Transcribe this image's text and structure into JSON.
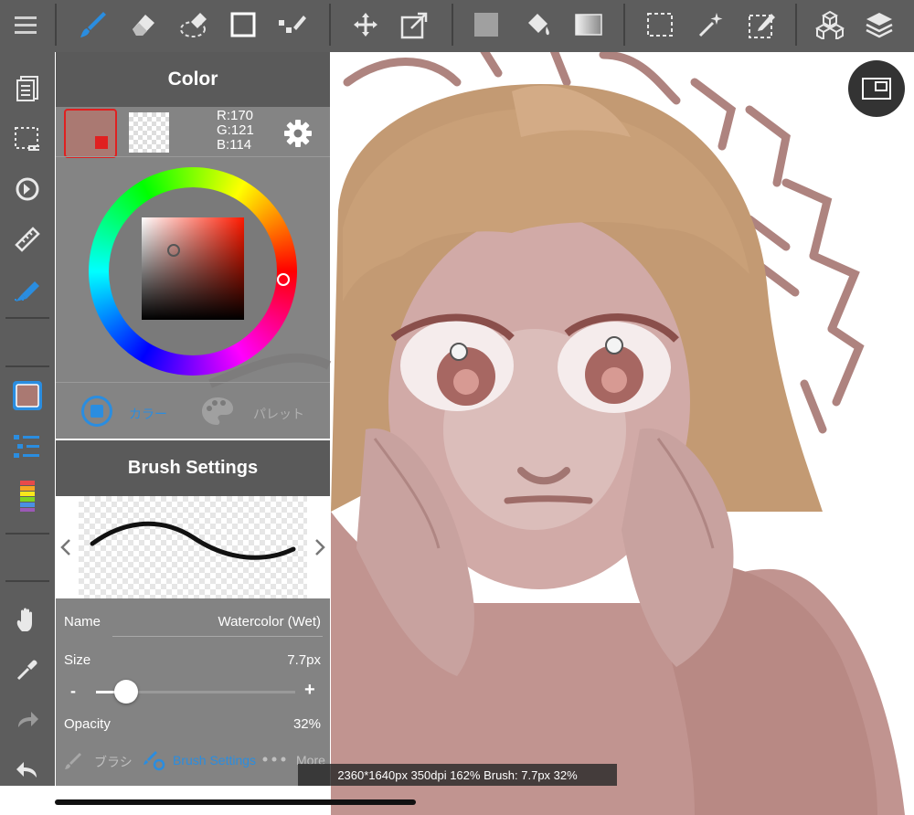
{
  "colors": {
    "toolbar": "#5d5d5d",
    "accent": "#2a8de0",
    "current_color": "#aa7972"
  },
  "color_panel": {
    "title": "Color",
    "rgb": {
      "r": "R:170",
      "g": "G:121",
      "b": "B:114"
    },
    "tabs": {
      "color": "カラー",
      "palette": "パレット"
    }
  },
  "brush_panel": {
    "title": "Brush Settings",
    "name_label": "Name",
    "name_value": "Watercolor (Wet)",
    "size_label": "Size",
    "size_value": "7.7px",
    "size_minus": "-",
    "size_plus": "+",
    "size_fraction": 0.15,
    "opacity_label": "Opacity",
    "opacity_value": "32%",
    "footer": {
      "brush": "ブラシ",
      "brush_settings": "Brush Settings",
      "more": "More"
    }
  },
  "status": "2360*1640px 350dpi 162% Brush: 7.7px 32%"
}
